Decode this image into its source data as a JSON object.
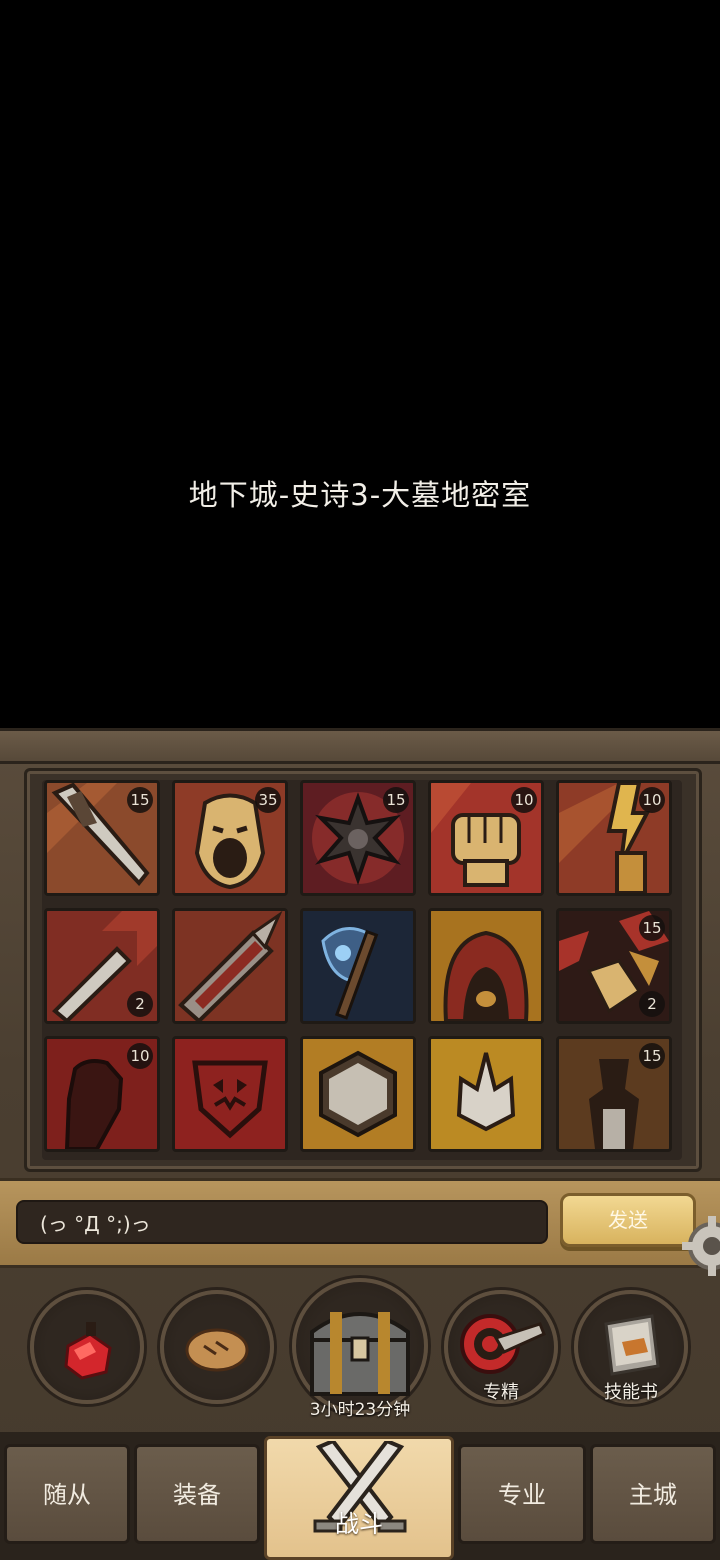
{
  "dungeon": {
    "title": "地下城-史诗3-大墓地密室"
  },
  "skills": [
    {
      "icon": "dagger-slash-icon",
      "count": "15",
      "count_pos": "top"
    },
    {
      "icon": "screaming-face-icon",
      "count": "35",
      "count_pos": "top"
    },
    {
      "icon": "spiked-mace-icon",
      "count": "15",
      "count_pos": "top"
    },
    {
      "icon": "fist-icon",
      "count": "10",
      "count_pos": "top"
    },
    {
      "icon": "lightning-bolt-icon",
      "count": "10",
      "count_pos": "top"
    },
    {
      "icon": "arrow-sword-icon",
      "count": "2",
      "count_pos": "bottom"
    },
    {
      "icon": "greatsword-icon",
      "count": "",
      "count_pos": "top"
    },
    {
      "icon": "frost-axe-icon",
      "count": "",
      "count_pos": "top"
    },
    {
      "icon": "hood-icon",
      "count": "",
      "count_pos": "top"
    },
    {
      "icon": "shatter-icon",
      "count": "15",
      "count_pos": "top",
      "count2": "2"
    },
    {
      "icon": "raised-fist-icon",
      "count": "10",
      "count_pos": "top"
    },
    {
      "icon": "war-banner-icon",
      "count": "",
      "count_pos": "top"
    },
    {
      "icon": "shield-hexagon-icon",
      "count": "",
      "count_pos": "top"
    },
    {
      "icon": "crown-spike-icon",
      "count": "",
      "count_pos": "top"
    },
    {
      "icon": "totem-icon",
      "count": "15",
      "count_pos": "top"
    }
  ],
  "chat": {
    "input_value": "(っ °Д °;)っ",
    "send_label": "发送"
  },
  "actions": {
    "potion": {
      "icon": "red-potion-icon"
    },
    "bread": {
      "icon": "bread-icon"
    },
    "chest": {
      "icon": "treasure-chest-icon",
      "timer": "3小时23分钟"
    },
    "specialization": {
      "icon": "target-sword-icon",
      "label": "专精"
    },
    "skillbook": {
      "icon": "skill-book-icon",
      "label": "技能书"
    }
  },
  "nav": {
    "tabs": [
      {
        "label": "随从",
        "active": false
      },
      {
        "label": "装备",
        "active": false
      },
      {
        "label": "战斗",
        "active": true
      },
      {
        "label": "专业",
        "active": false
      },
      {
        "label": "主城",
        "active": false
      }
    ]
  },
  "colors": {
    "accent_gold": "#d8b35e",
    "panel_brown": "#4b3f31",
    "slot_red": "#7a2a20",
    "slot_gold": "#b07a22"
  }
}
